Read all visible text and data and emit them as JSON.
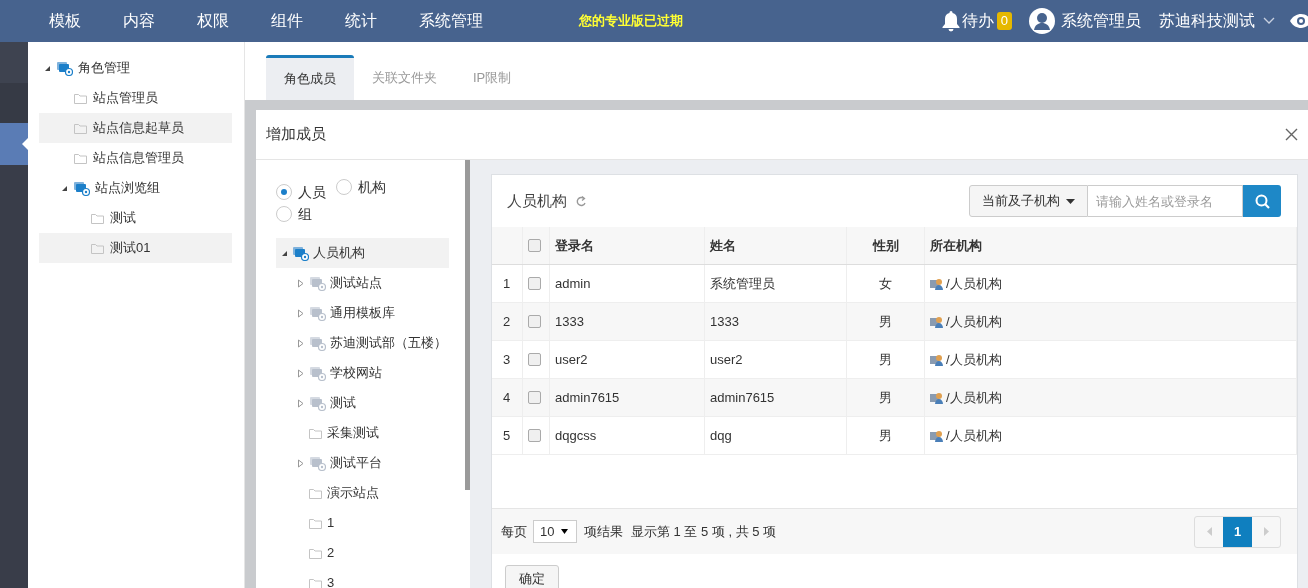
{
  "top_nav": {
    "items": [
      "模板",
      "内容",
      "权限",
      "组件",
      "统计",
      "系统管理"
    ],
    "notice": "您的专业版已过期",
    "todo": {
      "label": "待办",
      "count": "0"
    },
    "user": "系统管理员",
    "org": "苏迪科技测试"
  },
  "role_tree": [
    {
      "label": "角色管理",
      "kind": "group",
      "expanded": true,
      "highlighted": false,
      "children": [
        {
          "label": "站点管理员",
          "kind": "folder",
          "highlighted": false
        },
        {
          "label": "站点信息起草员",
          "kind": "folder",
          "highlighted": true
        },
        {
          "label": "站点信息管理员",
          "kind": "folder",
          "highlighted": false
        },
        {
          "label": "站点浏览组",
          "kind": "group",
          "expanded": true,
          "highlighted": false,
          "children": [
            {
              "label": "测试",
              "kind": "folder",
              "highlighted": false
            },
            {
              "label": "测试01",
              "kind": "folder",
              "highlighted": true
            }
          ]
        }
      ]
    }
  ],
  "tabs": [
    {
      "label": "角色成员",
      "selected": true
    },
    {
      "label": "关联文件夹",
      "selected": false
    },
    {
      "label": "IP限制",
      "selected": false
    }
  ],
  "modal": {
    "title": "增加成员",
    "radios": [
      {
        "label": "人员",
        "selected": true
      },
      {
        "label": "机构",
        "selected": false
      },
      {
        "label": "组",
        "selected": false
      }
    ],
    "org_tree": {
      "label": "人员机构",
      "expanded": true,
      "children": [
        {
          "label": "测试站点",
          "kind": "org",
          "expanded": false
        },
        {
          "label": "通用模板库",
          "kind": "org",
          "expanded": false
        },
        {
          "label": "苏迪测试部（五楼）",
          "kind": "org",
          "expanded": false
        },
        {
          "label": "学校网站",
          "kind": "org",
          "expanded": false
        },
        {
          "label": "测试",
          "kind": "org",
          "expanded": false
        },
        {
          "label": "采集测试",
          "kind": "folder"
        },
        {
          "label": "测试平台",
          "kind": "org",
          "expanded": false
        },
        {
          "label": "演示站点",
          "kind": "folder"
        },
        {
          "label": "1",
          "kind": "folder"
        },
        {
          "label": "2",
          "kind": "folder"
        },
        {
          "label": "3",
          "kind": "folder"
        }
      ]
    },
    "panel": {
      "title": "人员机构",
      "select_all_checked": false,
      "scope": "当前及子机构",
      "search": {
        "placeholder": "请输入姓名或登录名"
      },
      "columns": [
        "登录名",
        "姓名",
        "性别",
        "所在机构"
      ],
      "rows": [
        {
          "index": "1",
          "checked": false,
          "login": "admin",
          "name": "系统管理员",
          "gender": "女",
          "org": "/人员机构"
        },
        {
          "index": "2",
          "checked": false,
          "login": "1333",
          "name": "1333",
          "gender": "男",
          "org": "/人员机构"
        },
        {
          "index": "3",
          "checked": false,
          "login": "user2",
          "name": "user2",
          "gender": "男",
          "org": "/人员机构"
        },
        {
          "index": "4",
          "checked": false,
          "login": "admin7615",
          "name": "admin7615",
          "gender": "男",
          "org": "/人员机构"
        },
        {
          "index": "5",
          "checked": false,
          "login": "dqgcss",
          "name": "dqg",
          "gender": "男",
          "org": "/人员机构"
        }
      ],
      "footer": {
        "per_page_label": "每页",
        "per_page": "10",
        "results_label": "项结果",
        "summary": "显示第 1 至 5 项 , 共 5 项",
        "pages": [
          {
            "label": "1",
            "selected": true
          }
        ]
      }
    },
    "confirm_button": "确定"
  }
}
